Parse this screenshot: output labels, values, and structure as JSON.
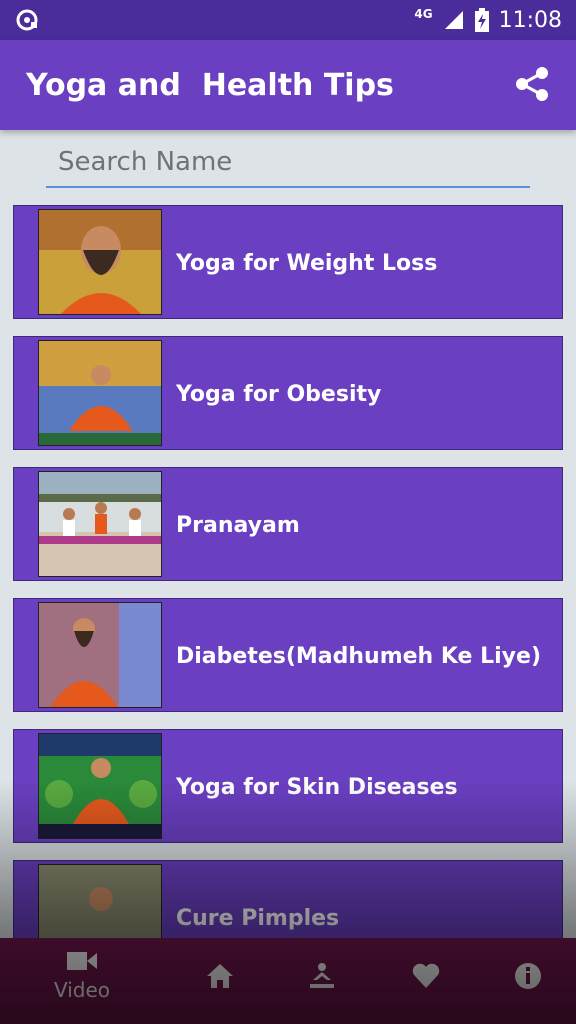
{
  "status_bar": {
    "network": "4G",
    "time": "11:08"
  },
  "app_bar": {
    "title": "Yoga and  Health Tips",
    "share_icon": "share-icon"
  },
  "search": {
    "placeholder": "Search Name",
    "value": ""
  },
  "items": [
    {
      "label": "Yoga for Weight Loss"
    },
    {
      "label": "Yoga for Obesity"
    },
    {
      "label": "Pranayam"
    },
    {
      "label": "Diabetes(Madhumeh Ke Liye)"
    },
    {
      "label": "Yoga for Skin Diseases"
    },
    {
      "label": "Cure Pimples"
    }
  ],
  "bottom_nav": {
    "video_label": "Video",
    "icons": [
      "video-icon",
      "home-icon",
      "yoga-pose-icon",
      "heart-icon",
      "info-icon"
    ]
  },
  "colors": {
    "primary": "#6a3fc1",
    "status_bar": "#4a2c9a",
    "nav_bar": "#73164f",
    "search_underline": "#5b8fd6"
  }
}
